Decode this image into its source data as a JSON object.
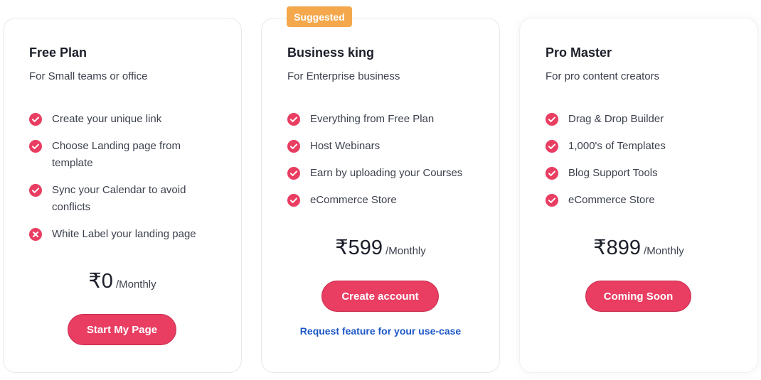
{
  "colors": {
    "accent": "#e93d62",
    "badge": "#f4a84b",
    "link": "#1d57c7",
    "check": "#e93d62",
    "cross": "#e93d62"
  },
  "plans": [
    {
      "title": "Free Plan",
      "subtitle": "For Small teams or office",
      "features": [
        {
          "icon": "check-circle-icon",
          "text": "Create your unique link"
        },
        {
          "icon": "check-circle-icon",
          "text": "Choose Landing page from template"
        },
        {
          "icon": "check-circle-icon",
          "text": "Sync your Calendar to avoid conflicts"
        },
        {
          "icon": "cross-circle-icon",
          "text": "White Label your landing page"
        }
      ],
      "price": "₹0",
      "period": "/Monthly",
      "button_label": "Start My Page"
    },
    {
      "badge": "Suggested",
      "title": "Business king",
      "subtitle": "For Enterprise business",
      "features": [
        {
          "icon": "check-circle-icon",
          "text": "Everything from Free Plan"
        },
        {
          "icon": "check-circle-icon",
          "text": "Host Webinars"
        },
        {
          "icon": "check-circle-icon",
          "text": "Earn by uploading your Courses"
        },
        {
          "icon": "check-circle-icon",
          "text": "eCommerce Store"
        }
      ],
      "price": "₹599",
      "period": "/Monthly",
      "button_label": "Create account",
      "link_label": "Request feature for your use-case"
    },
    {
      "title": "Pro Master",
      "subtitle": "For pro content creators",
      "features": [
        {
          "icon": "check-circle-icon",
          "text": "Drag & Drop Builder"
        },
        {
          "icon": "check-circle-icon",
          "text": "1,000's of Templates"
        },
        {
          "icon": "check-circle-icon",
          "text": "Blog Support Tools"
        },
        {
          "icon": "check-circle-icon",
          "text": "eCommerce Store"
        }
      ],
      "price": "₹899",
      "period": "/Monthly",
      "button_label": "Coming Soon"
    }
  ]
}
